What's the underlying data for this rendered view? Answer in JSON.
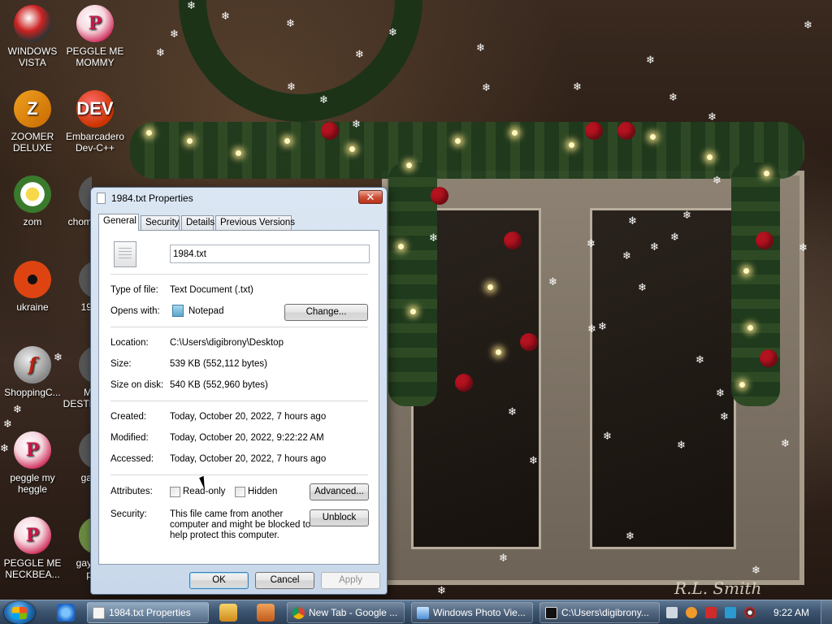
{
  "desktop": {
    "icons": [
      {
        "label": "WINDOWS\nVISTA"
      },
      {
        "label": "PEGGLE ME\nMOMMY"
      },
      {
        "label": "ZOOMER\nDELUXE"
      },
      {
        "label": "Embarcadero\nDev-C++"
      },
      {
        "label": "zom"
      },
      {
        "label": "chom"
      },
      {
        "label": "ukraine"
      },
      {
        "label": "19"
      },
      {
        "label": "ShoppingC..."
      },
      {
        "label": "M\nDESTI"
      },
      {
        "label": "peggle my\nheggle"
      },
      {
        "label": "ga"
      },
      {
        "label": "PEGGLE ME\nNECKBEA..."
      },
      {
        "label": "gay\np"
      }
    ],
    "wallpaper_signature": "R.L. Smith"
  },
  "dialog": {
    "title": "1984.txt Properties",
    "close_glyph": "✕",
    "tabs": [
      {
        "label": "General"
      },
      {
        "label": "Security"
      },
      {
        "label": "Details"
      },
      {
        "label": "Previous Versions"
      }
    ],
    "filename": "1984.txt",
    "type_label": "Type of file:",
    "type_value": "Text Document (.txt)",
    "opens_label": "Opens with:",
    "opens_value": "Notepad",
    "change_button": "Change...",
    "location_label": "Location:",
    "location_value": "C:\\Users\\digibrony\\Desktop",
    "size_label": "Size:",
    "size_value": "539 KB (552,112 bytes)",
    "size_disk_label": "Size on disk:",
    "size_disk_value": "540 KB (552,960 bytes)",
    "created_label": "Created:",
    "created_value": "Today, October 20, 2022, 7 hours ago",
    "modified_label": "Modified:",
    "modified_value": "Today, October 20, 2022, 9:22:22 AM",
    "accessed_label": "Accessed:",
    "accessed_value": "Today, October 20, 2022, 7 hours ago",
    "attributes_label": "Attributes:",
    "readonly_label": "Read-only",
    "hidden_label": "Hidden",
    "advanced_button": "Advanced...",
    "security_label": "Security:",
    "security_text_1": "This file came from another",
    "security_text_2": "computer and might be blocked to",
    "security_text_3": "help protect this computer.",
    "unblock_button": "Unblock",
    "ok_button": "OK",
    "cancel_button": "Cancel",
    "apply_button": "Apply"
  },
  "taskbar": {
    "windows": [
      {
        "label": "1984.txt Properties"
      },
      {
        "label": "New Tab - Google ..."
      },
      {
        "label": "Windows Photo Vie..."
      },
      {
        "label": "C:\\Users\\digibrony..."
      }
    ],
    "clock": "9:22 AM"
  },
  "colors": {
    "accent": "#3c7fb1",
    "close_red": "#c8442c",
    "taskbar": "#3d5571"
  }
}
